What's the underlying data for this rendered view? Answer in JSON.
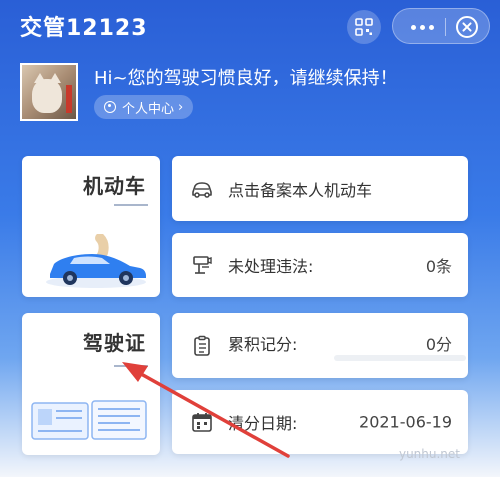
{
  "header": {
    "title": "交管12123",
    "scan_icon": "qr-scan-icon",
    "more_icon": "more-icon",
    "close_icon": "close-icon"
  },
  "user": {
    "greeting": "Hi~您的驾驶习惯良好，请继续保持！",
    "center_label": "个人中心",
    "center_chevron": "›"
  },
  "vehicle": {
    "title": "机动车",
    "register_text": "点击备案本人机动车",
    "violation_label": "未处理违法:",
    "violation_value": "0条"
  },
  "license": {
    "title": "驾驶证",
    "points_label": "累积记分:",
    "points_value": "0分",
    "points_progress": 0,
    "clear_label": "清分日期:",
    "clear_date": "2021-06-19"
  },
  "watermark": "yunhu.net",
  "colors": {
    "brand": "#2a5fd6",
    "accent": "#3a7be8",
    "arrow": "#e0403a"
  }
}
